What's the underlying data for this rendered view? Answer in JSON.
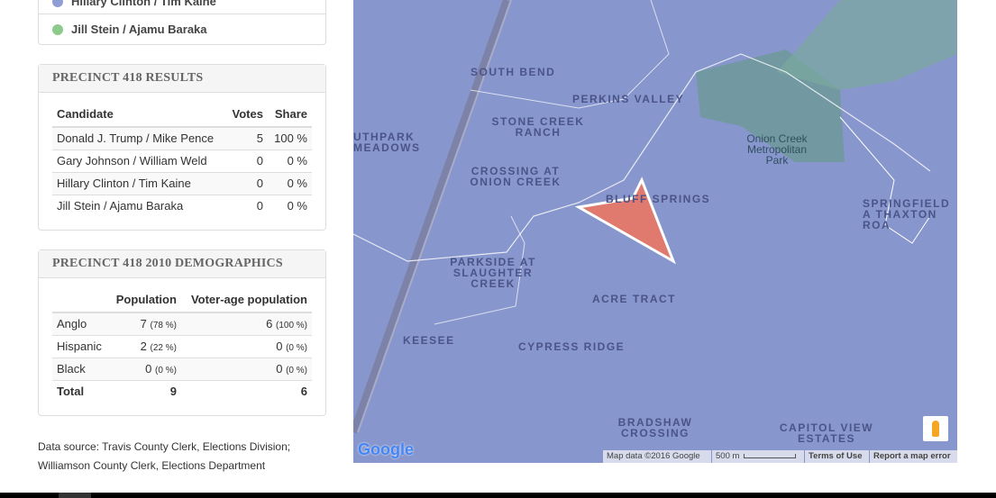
{
  "legend": {
    "items": [
      {
        "label": "Hillary Clinton / Tim Kaine",
        "color": "#8e9dd6"
      },
      {
        "label": "Jill Stein / Ajamu Baraka",
        "color": "#8cc98a"
      }
    ]
  },
  "results": {
    "title": "PRECINCT 418 RESULTS",
    "headers": [
      "Candidate",
      "Votes",
      "Share"
    ],
    "rows": [
      [
        "Donald J. Trump / Mike Pence",
        "5",
        "100 %"
      ],
      [
        "Gary Johnson / William Weld",
        "0",
        "0 %"
      ],
      [
        "Hillary Clinton / Tim Kaine",
        "0",
        "0 %"
      ],
      [
        "Jill Stein / Ajamu Baraka",
        "0",
        "0 %"
      ]
    ]
  },
  "demographics": {
    "title": "PRECINCT 418 2010 DEMOGRAPHICS",
    "headers": [
      "",
      "Population",
      "Voter-age population"
    ],
    "rows": [
      {
        "group": "Anglo",
        "pop": "7",
        "pop_pct": "(78 %)",
        "vap": "6",
        "vap_pct": "(100 %)"
      },
      {
        "group": "Hispanic",
        "pop": "2",
        "pop_pct": "(22 %)",
        "vap": "0",
        "vap_pct": "(0 %)"
      },
      {
        "group": "Black",
        "pop": "0",
        "pop_pct": "(0 %)",
        "vap": "0",
        "vap_pct": "(0 %)"
      }
    ],
    "total": {
      "label": "Total",
      "pop": "9",
      "vap": "6"
    }
  },
  "source": {
    "line1": "Data source: Travis County Clerk, Elections Division;",
    "line2": "Williamson County Clerk, Elections Department"
  },
  "map": {
    "labels": [
      "SOUTH BEND",
      "PERKINS VALLEY",
      "STONE CREEK RANCH",
      "CROSSING AT ONION CREEK",
      "BLUFF SPRINGS",
      "UTHPARK MEADOWS",
      "PARKSIDE AT SLAUGHTER CREEK",
      "ACRE TRACT",
      "KEESEE",
      "CYPRESS RIDGE",
      "BRADSHAW CROSSING",
      "CAPITOL VIEW ESTATES",
      "Onion Creek Metropolitan Park",
      "SPRINGFIELD A THAXTON ROA"
    ],
    "attribution": "Map data ©2016 Google",
    "scale": "500 m",
    "terms": "Terms of Use",
    "report": "Report a map error",
    "logo": "Google"
  }
}
